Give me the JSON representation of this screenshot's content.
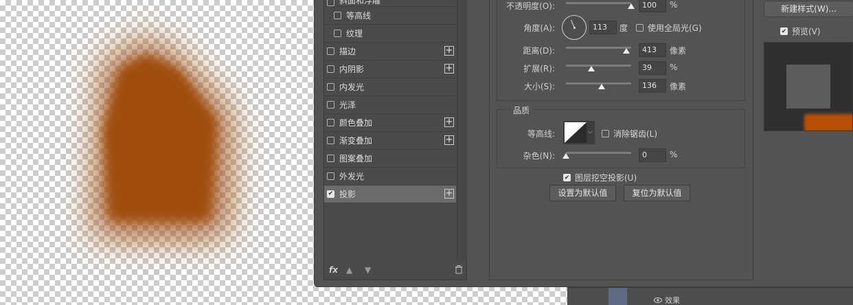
{
  "effects_list": [
    {
      "label": "斜面和浮雕",
      "checked": false,
      "sub": false,
      "plus": false,
      "active": false,
      "partial": true
    },
    {
      "label": "等高线",
      "checked": false,
      "sub": true,
      "plus": false,
      "active": false
    },
    {
      "label": "纹理",
      "checked": false,
      "sub": true,
      "plus": false,
      "active": false
    },
    {
      "label": "描边",
      "checked": false,
      "sub": false,
      "plus": true,
      "active": false
    },
    {
      "label": "内阴影",
      "checked": false,
      "sub": false,
      "plus": true,
      "active": false
    },
    {
      "label": "内发光",
      "checked": false,
      "sub": false,
      "plus": false,
      "active": false
    },
    {
      "label": "光泽",
      "checked": false,
      "sub": false,
      "plus": false,
      "active": false
    },
    {
      "label": "颜色叠加",
      "checked": false,
      "sub": false,
      "plus": true,
      "active": false
    },
    {
      "label": "渐变叠加",
      "checked": false,
      "sub": false,
      "plus": true,
      "active": false
    },
    {
      "label": "图案叠加",
      "checked": false,
      "sub": false,
      "plus": false,
      "active": false
    },
    {
      "label": "外发光",
      "checked": false,
      "sub": false,
      "plus": false,
      "active": false
    },
    {
      "label": "投影",
      "checked": true,
      "sub": false,
      "plus": true,
      "active": true
    }
  ],
  "fx_footer": {
    "fx_label": "fx",
    "up_icon": "arrow-up-icon",
    "down_icon": "arrow-down-icon",
    "trash_icon": "trash-icon"
  },
  "structure": {
    "opacity": {
      "label": "不透明度(O):",
      "value": "100",
      "unit": "%",
      "level": 1.0
    },
    "angle": {
      "label": "角度(A):",
      "value": "113",
      "unit": "度"
    },
    "global_light": {
      "label": "使用全局光(G)",
      "checked": false
    },
    "distance": {
      "label": "距离(D):",
      "value": "413",
      "unit": "像素",
      "level": 0.93
    },
    "spread": {
      "label": "扩展(R):",
      "value": "39",
      "unit": "%",
      "level": 0.39
    },
    "size": {
      "label": "大小(S):",
      "value": "136",
      "unit": "像素",
      "level": 0.55
    }
  },
  "quality": {
    "title": "品质",
    "contour_label": "等高线:",
    "anti_alias": {
      "label": "消除锯齿(L)",
      "checked": false
    },
    "noise": {
      "label": "杂色(N):",
      "value": "0",
      "unit": "%",
      "level": 0.0
    }
  },
  "knockout": {
    "label": "图层挖空投影(U)",
    "checked": true
  },
  "buttons": {
    "set_default": "设置为默认值",
    "reset_default": "复位为默认值",
    "new_style": "新建样式(W)..."
  },
  "preview": {
    "label": "预览(V)",
    "checked": true
  },
  "layers": {
    "effects_label": "效果",
    "eye_icon": "eye-icon"
  },
  "colors": {
    "shadow": "#a04e08",
    "preview_shadow": "#b84f07",
    "dialog_bg": "#535353"
  }
}
